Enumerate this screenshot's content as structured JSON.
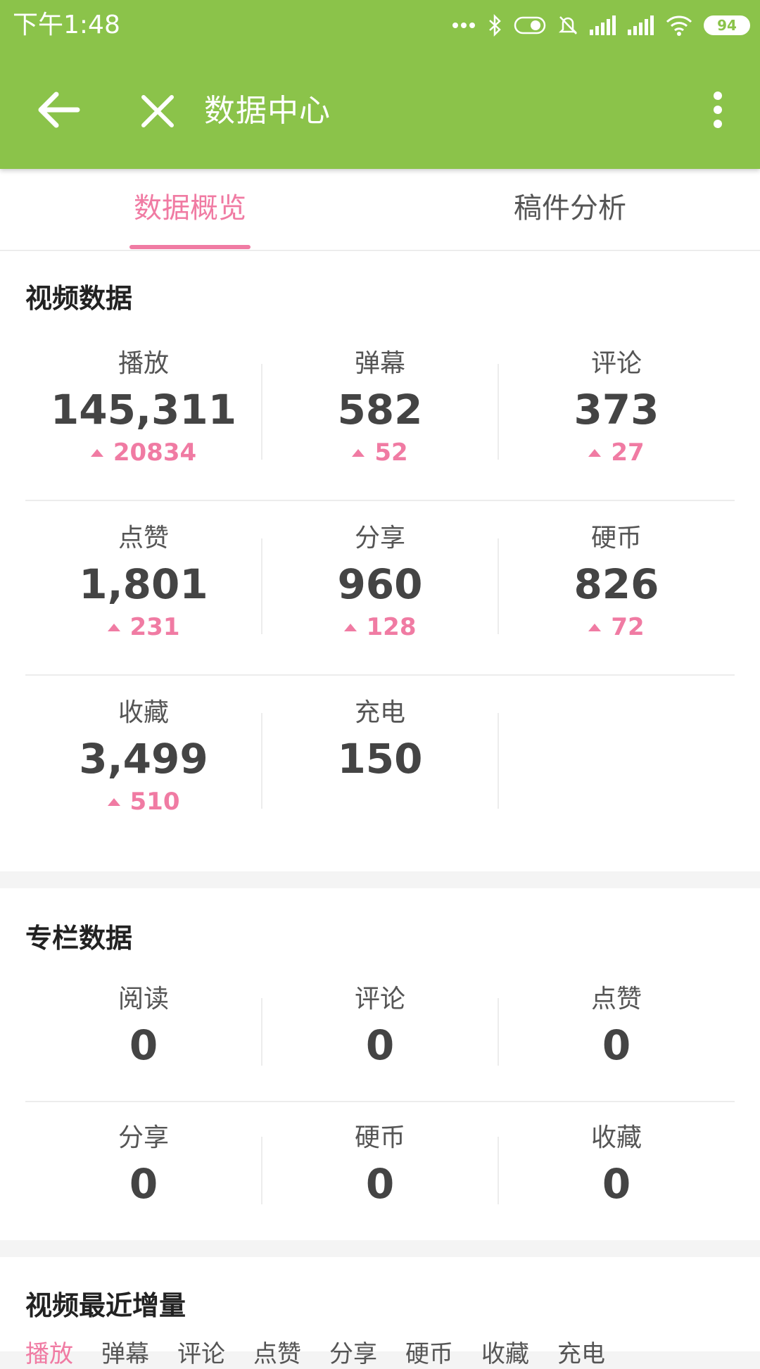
{
  "status_bar": {
    "time": "下午1:48",
    "battery": "94",
    "icons": [
      "more-dots-icon",
      "bluetooth-icon",
      "toggle-icon",
      "mute-icon",
      "signal-icon",
      "signal-icon",
      "wifi-icon",
      "battery-icon"
    ]
  },
  "app_bar": {
    "title": "数据中心",
    "color": "#8bc34a"
  },
  "tabs": [
    {
      "label": "数据概览",
      "active": true
    },
    {
      "label": "稿件分析",
      "active": false
    }
  ],
  "accent_color": "#f07ba3",
  "video_data": {
    "title": "视频数据",
    "rows": [
      [
        {
          "label": "播放",
          "value": "145,311",
          "delta": "20834"
        },
        {
          "label": "弹幕",
          "value": "582",
          "delta": "52"
        },
        {
          "label": "评论",
          "value": "373",
          "delta": "27"
        }
      ],
      [
        {
          "label": "点赞",
          "value": "1,801",
          "delta": "231"
        },
        {
          "label": "分享",
          "value": "960",
          "delta": "128"
        },
        {
          "label": "硬币",
          "value": "826",
          "delta": "72"
        }
      ],
      [
        {
          "label": "收藏",
          "value": "3,499",
          "delta": "510"
        },
        {
          "label": "充电",
          "value": "150",
          "delta": ""
        }
      ]
    ]
  },
  "column_data": {
    "title": "专栏数据",
    "rows": [
      [
        {
          "label": "阅读",
          "value": "0"
        },
        {
          "label": "评论",
          "value": "0"
        },
        {
          "label": "点赞",
          "value": "0"
        }
      ],
      [
        {
          "label": "分享",
          "value": "0"
        },
        {
          "label": "硬币",
          "value": "0"
        },
        {
          "label": "收藏",
          "value": "0"
        }
      ]
    ]
  },
  "recent_increase": {
    "title": "视频最近增量",
    "tabs": [
      "播放",
      "弹幕",
      "评论",
      "点赞",
      "分享",
      "硬币",
      "收藏",
      "充电"
    ]
  }
}
